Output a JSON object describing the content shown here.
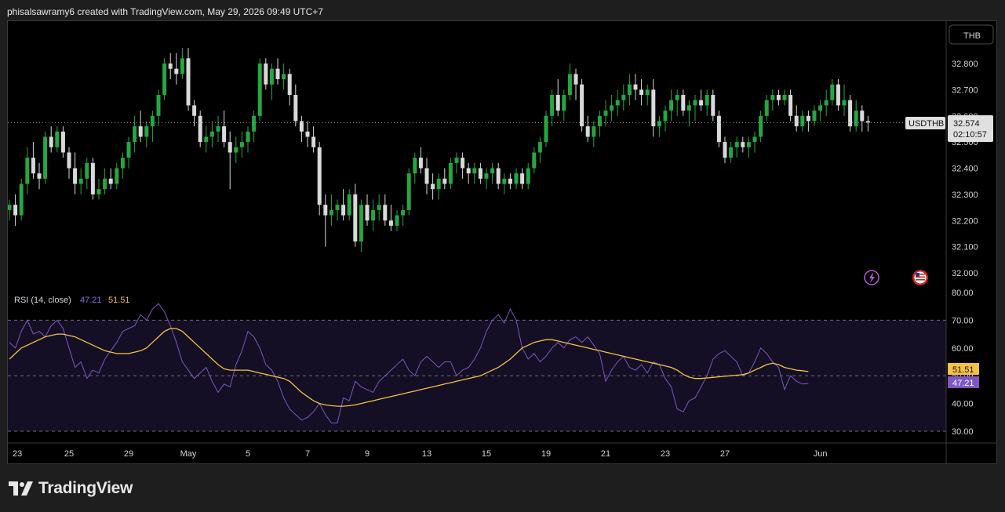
{
  "header": {
    "attribution": "phisalsawramy6 created with TradingView.com, May 29, 2026 09:49 UTC+7"
  },
  "footer": {
    "brand": "TradingView"
  },
  "currency_button": "THB",
  "colors": {
    "up": "#26a641",
    "down": "#d9d9d9",
    "rsi": "#7e57c2",
    "rsi_ma": "#f5c242",
    "rsi_band": "#140f24",
    "price_line": "#9e9e9e"
  },
  "icons": [
    "lightning-icon",
    "us-flag-icon"
  ],
  "chart_data": [
    {
      "type": "candlestick",
      "symbol": "USDTHB",
      "last_price": "32.574",
      "countdown": "02:10:57",
      "ylim": [
        32.0,
        32.85
      ],
      "y_ticks": [
        "32.000",
        "32.100",
        "32.200",
        "32.300",
        "32.400",
        "32.500",
        "32.600",
        "32.700",
        "32.800"
      ],
      "x_ticks": [
        {
          "label": "23",
          "i": 0
        },
        {
          "label": "25",
          "i": 10
        },
        {
          "label": "29",
          "i": 20
        },
        {
          "label": "May",
          "i": 30
        },
        {
          "label": "5",
          "i": 40
        },
        {
          "label": "7",
          "i": 50
        },
        {
          "label": "9",
          "i": 60
        },
        {
          "label": "13",
          "i": 70
        },
        {
          "label": "15",
          "i": 80
        },
        {
          "label": "19",
          "i": 90
        },
        {
          "label": "21",
          "i": 100
        },
        {
          "label": "23",
          "i": 110
        },
        {
          "label": "27",
          "i": 120
        },
        {
          "label": "Jun",
          "i": 136
        }
      ],
      "candles": [
        [
          32.24,
          32.28,
          32.2,
          32.26
        ],
        [
          32.26,
          32.3,
          32.18,
          32.22
        ],
        [
          32.22,
          32.36,
          32.2,
          32.34
        ],
        [
          32.34,
          32.48,
          32.3,
          32.44
        ],
        [
          32.44,
          32.5,
          32.36,
          32.38
        ],
        [
          32.38,
          32.42,
          32.32,
          32.36
        ],
        [
          32.36,
          32.54,
          32.34,
          32.52
        ],
        [
          32.52,
          32.56,
          32.46,
          32.48
        ],
        [
          32.48,
          32.56,
          32.46,
          32.54
        ],
        [
          32.54,
          32.56,
          32.44,
          32.46
        ],
        [
          32.46,
          32.48,
          32.36,
          32.4
        ],
        [
          32.4,
          32.46,
          32.3,
          32.34
        ],
        [
          32.34,
          32.4,
          32.3,
          32.36
        ],
        [
          32.36,
          32.44,
          32.32,
          32.42
        ],
        [
          32.42,
          32.44,
          32.28,
          32.3
        ],
        [
          32.3,
          32.36,
          32.28,
          32.32
        ],
        [
          32.32,
          32.4,
          32.3,
          32.36
        ],
        [
          32.36,
          32.4,
          32.32,
          32.34
        ],
        [
          32.34,
          32.42,
          32.32,
          32.4
        ],
        [
          32.4,
          32.46,
          32.36,
          32.44
        ],
        [
          32.44,
          32.52,
          32.4,
          32.5
        ],
        [
          32.5,
          32.6,
          32.46,
          32.56
        ],
        [
          32.56,
          32.62,
          32.5,
          32.52
        ],
        [
          32.52,
          32.58,
          32.48,
          32.56
        ],
        [
          32.56,
          32.62,
          32.5,
          32.6
        ],
        [
          32.6,
          32.7,
          32.56,
          32.68
        ],
        [
          32.68,
          32.82,
          32.66,
          32.8
        ],
        [
          32.8,
          32.84,
          32.74,
          32.78
        ],
        [
          32.78,
          32.84,
          32.72,
          32.76
        ],
        [
          32.76,
          32.86,
          32.74,
          32.82
        ],
        [
          32.82,
          32.86,
          32.62,
          32.64
        ],
        [
          32.64,
          32.66,
          32.56,
          32.6
        ],
        [
          32.6,
          32.62,
          32.48,
          32.5
        ],
        [
          32.5,
          32.56,
          32.46,
          32.52
        ],
        [
          32.52,
          32.58,
          32.48,
          32.54
        ],
        [
          32.54,
          32.6,
          32.5,
          32.56
        ],
        [
          32.56,
          32.62,
          32.48,
          32.5
        ],
        [
          32.5,
          32.54,
          32.32,
          32.46
        ],
        [
          32.46,
          32.52,
          32.42,
          32.48
        ],
        [
          32.48,
          32.54,
          32.44,
          32.5
        ],
        [
          32.5,
          32.56,
          32.46,
          32.54
        ],
        [
          32.54,
          32.62,
          32.5,
          32.6
        ],
        [
          32.6,
          32.82,
          32.58,
          32.8
        ],
        [
          32.8,
          32.82,
          32.7,
          32.72
        ],
        [
          32.72,
          32.8,
          32.66,
          32.78
        ],
        [
          32.78,
          32.82,
          32.72,
          32.74
        ],
        [
          32.74,
          32.8,
          32.7,
          32.76
        ],
        [
          32.76,
          32.78,
          32.64,
          32.68
        ],
        [
          32.68,
          32.72,
          32.56,
          32.58
        ],
        [
          32.58,
          32.6,
          32.5,
          32.54
        ],
        [
          32.54,
          32.58,
          32.48,
          32.52
        ],
        [
          32.52,
          32.56,
          32.46,
          32.48
        ],
        [
          32.48,
          32.5,
          32.22,
          32.26
        ],
        [
          32.26,
          32.3,
          32.1,
          32.22
        ],
        [
          32.22,
          32.3,
          32.18,
          32.24
        ],
        [
          32.24,
          32.28,
          32.2,
          32.26
        ],
        [
          32.26,
          32.32,
          32.2,
          32.22
        ],
        [
          32.22,
          32.32,
          32.2,
          32.3
        ],
        [
          32.3,
          32.34,
          32.1,
          32.12
        ],
        [
          32.12,
          32.28,
          32.08,
          32.26
        ],
        [
          32.26,
          32.3,
          32.18,
          32.2
        ],
        [
          32.2,
          32.28,
          32.16,
          32.24
        ],
        [
          32.24,
          32.3,
          32.2,
          32.26
        ],
        [
          32.26,
          32.3,
          32.18,
          32.2
        ],
        [
          32.2,
          32.26,
          32.16,
          32.18
        ],
        [
          32.18,
          32.24,
          32.16,
          32.22
        ],
        [
          32.22,
          32.26,
          32.18,
          32.24
        ],
        [
          32.24,
          32.4,
          32.22,
          32.38
        ],
        [
          32.38,
          32.46,
          32.34,
          32.44
        ],
        [
          32.44,
          32.48,
          32.38,
          32.4
        ],
        [
          32.4,
          32.44,
          32.3,
          32.34
        ],
        [
          32.34,
          32.38,
          32.28,
          32.32
        ],
        [
          32.32,
          32.38,
          32.28,
          32.36
        ],
        [
          32.36,
          32.4,
          32.32,
          32.34
        ],
        [
          32.34,
          32.44,
          32.32,
          32.42
        ],
        [
          32.42,
          32.46,
          32.38,
          32.44
        ],
        [
          32.44,
          32.46,
          32.36,
          32.4
        ],
        [
          32.4,
          32.42,
          32.34,
          32.38
        ],
        [
          32.38,
          32.42,
          32.34,
          32.4
        ],
        [
          32.4,
          32.42,
          32.34,
          32.36
        ],
        [
          32.36,
          32.4,
          32.32,
          32.38
        ],
        [
          32.38,
          32.42,
          32.34,
          32.4
        ],
        [
          32.4,
          32.42,
          32.32,
          32.34
        ],
        [
          32.34,
          32.38,
          32.3,
          32.36
        ],
        [
          32.36,
          32.38,
          32.32,
          32.34
        ],
        [
          32.34,
          32.4,
          32.32,
          32.38
        ],
        [
          32.38,
          32.4,
          32.32,
          32.34
        ],
        [
          32.34,
          32.42,
          32.32,
          32.4
        ],
        [
          32.4,
          32.48,
          32.38,
          32.46
        ],
        [
          32.46,
          32.52,
          32.42,
          32.5
        ],
        [
          32.5,
          32.62,
          32.48,
          32.6
        ],
        [
          32.6,
          32.7,
          32.56,
          32.68
        ],
        [
          32.68,
          32.74,
          32.6,
          32.62
        ],
        [
          32.62,
          32.7,
          32.58,
          32.68
        ],
        [
          32.68,
          32.8,
          32.66,
          32.76
        ],
        [
          32.76,
          32.78,
          32.66,
          32.72
        ],
        [
          32.72,
          32.74,
          32.54,
          32.56
        ],
        [
          32.56,
          32.6,
          32.5,
          32.52
        ],
        [
          32.52,
          32.58,
          32.48,
          32.56
        ],
        [
          32.56,
          32.62,
          32.52,
          32.6
        ],
        [
          32.6,
          32.66,
          32.56,
          32.62
        ],
        [
          32.62,
          32.68,
          32.58,
          32.64
        ],
        [
          32.64,
          32.7,
          32.6,
          32.66
        ],
        [
          32.66,
          32.72,
          32.62,
          32.68
        ],
        [
          32.68,
          32.76,
          32.64,
          32.72
        ],
        [
          32.72,
          32.76,
          32.66,
          32.7
        ],
        [
          32.7,
          32.74,
          32.64,
          32.68
        ],
        [
          32.68,
          32.72,
          32.64,
          32.7
        ],
        [
          32.7,
          32.74,
          32.52,
          32.56
        ],
        [
          32.56,
          32.6,
          32.52,
          32.58
        ],
        [
          32.58,
          32.64,
          32.54,
          32.62
        ],
        [
          32.62,
          32.7,
          32.58,
          32.66
        ],
        [
          32.66,
          32.7,
          32.6,
          32.68
        ],
        [
          32.68,
          32.7,
          32.6,
          32.62
        ],
        [
          32.62,
          32.66,
          32.56,
          32.64
        ],
        [
          32.64,
          32.68,
          32.58,
          32.66
        ],
        [
          32.66,
          32.7,
          32.62,
          32.64
        ],
        [
          32.64,
          32.7,
          32.6,
          32.68
        ],
        [
          32.68,
          32.7,
          32.58,
          32.6
        ],
        [
          32.6,
          32.62,
          32.48,
          32.5
        ],
        [
          32.5,
          32.52,
          32.42,
          32.44
        ],
        [
          32.44,
          32.5,
          32.42,
          32.48
        ],
        [
          32.48,
          32.52,
          32.44,
          32.5
        ],
        [
          32.5,
          32.52,
          32.46,
          32.48
        ],
        [
          32.48,
          32.52,
          32.44,
          32.5
        ],
        [
          32.5,
          32.54,
          32.46,
          32.52
        ],
        [
          32.52,
          32.62,
          32.5,
          32.6
        ],
        [
          32.6,
          32.68,
          32.58,
          32.66
        ],
        [
          32.66,
          32.7,
          32.62,
          32.68
        ],
        [
          32.68,
          32.7,
          32.64,
          32.66
        ],
        [
          32.66,
          32.7,
          32.64,
          32.68
        ],
        [
          32.68,
          32.7,
          32.58,
          32.6
        ],
        [
          32.6,
          32.64,
          32.54,
          32.56
        ],
        [
          32.56,
          32.62,
          32.54,
          32.6
        ],
        [
          32.6,
          32.62,
          32.54,
          32.58
        ],
        [
          32.58,
          32.64,
          32.56,
          32.62
        ],
        [
          32.62,
          32.66,
          32.58,
          32.64
        ],
        [
          32.64,
          32.7,
          32.6,
          32.66
        ],
        [
          32.66,
          32.74,
          32.64,
          32.72
        ],
        [
          32.72,
          32.74,
          32.62,
          32.64
        ],
        [
          32.64,
          32.72,
          32.6,
          32.66
        ],
        [
          32.66,
          32.68,
          32.54,
          32.56
        ],
        [
          32.56,
          32.66,
          32.54,
          32.62
        ],
        [
          32.62,
          32.64,
          32.54,
          32.58
        ],
        [
          32.58,
          32.6,
          32.54,
          32.574
        ]
      ]
    },
    {
      "type": "line",
      "title": "RSI (14, close)",
      "rsi_value": "47.21",
      "ma_value": "51.51",
      "ylim": [
        28,
        82
      ],
      "y_ticks": [
        "30.00",
        "40.00",
        "50.00",
        "60.00",
        "70.00",
        "80.00"
      ],
      "bands": [
        30,
        50,
        70
      ],
      "series": [
        {
          "name": "RSI",
          "values": [
            62,
            60,
            66,
            70,
            65,
            66,
            64,
            68,
            70,
            67,
            60,
            53,
            55,
            49,
            52,
            51,
            56,
            59,
            62,
            66,
            67,
            68,
            72,
            70,
            74,
            76,
            73,
            68,
            62,
            55,
            52,
            49,
            51,
            53,
            48,
            44,
            47,
            46,
            54,
            59,
            66,
            64,
            60,
            54,
            52,
            48,
            42,
            38,
            36,
            34,
            35,
            37,
            40,
            36,
            33,
            33,
            42,
            41,
            48,
            46,
            45,
            44,
            48,
            50,
            52,
            54,
            56,
            52,
            50,
            55,
            57,
            55,
            53,
            55,
            55,
            50,
            52,
            53,
            56,
            60,
            66,
            70,
            72,
            69,
            74,
            70,
            60,
            56,
            58,
            55,
            57,
            60,
            62,
            60,
            63,
            64,
            62,
            64,
            61,
            58,
            48,
            52,
            55,
            57,
            53,
            52,
            54,
            51,
            55,
            54,
            49,
            46,
            38,
            37,
            41,
            42,
            46,
            50,
            56,
            58,
            59,
            57,
            55,
            50,
            51,
            55,
            60,
            58,
            55,
            53,
            45,
            50,
            48,
            47,
            47.21
          ]
        },
        {
          "name": "MA",
          "values": [
            56,
            58,
            60,
            61,
            62,
            63,
            64,
            64.5,
            65,
            65,
            64.5,
            64,
            63,
            62,
            61,
            60,
            59,
            58.5,
            58,
            58,
            58,
            58.5,
            59,
            60,
            62,
            64,
            66,
            67,
            67,
            66,
            64,
            62,
            60,
            58,
            56,
            54,
            52.5,
            52,
            52,
            52,
            52,
            51.5,
            51,
            50.5,
            50,
            49.5,
            49,
            48,
            46,
            44,
            42.5,
            41,
            40,
            39.5,
            39.2,
            39,
            39,
            39.2,
            39.5,
            40,
            40.5,
            41,
            41.5,
            42,
            42.5,
            43,
            43.5,
            44,
            44.5,
            45,
            45.5,
            46,
            46.5,
            47,
            47.5,
            48,
            48.5,
            49,
            49.5,
            50,
            51,
            52,
            53,
            54.5,
            56,
            58,
            60,
            61,
            62,
            62.5,
            63,
            63,
            62.5,
            62,
            61.5,
            61,
            60.5,
            60,
            59.5,
            59,
            58.5,
            58,
            57.5,
            57,
            56.5,
            56,
            55.5,
            55,
            54.5,
            54,
            53.5,
            53,
            52,
            50.5,
            49.5,
            49,
            49,
            49.2,
            49.4,
            49.6,
            49.8,
            50,
            50.2,
            50.4,
            51,
            52,
            53,
            54,
            54.5,
            54,
            53,
            52.5,
            52,
            51.8,
            51.51
          ]
        }
      ]
    }
  ]
}
